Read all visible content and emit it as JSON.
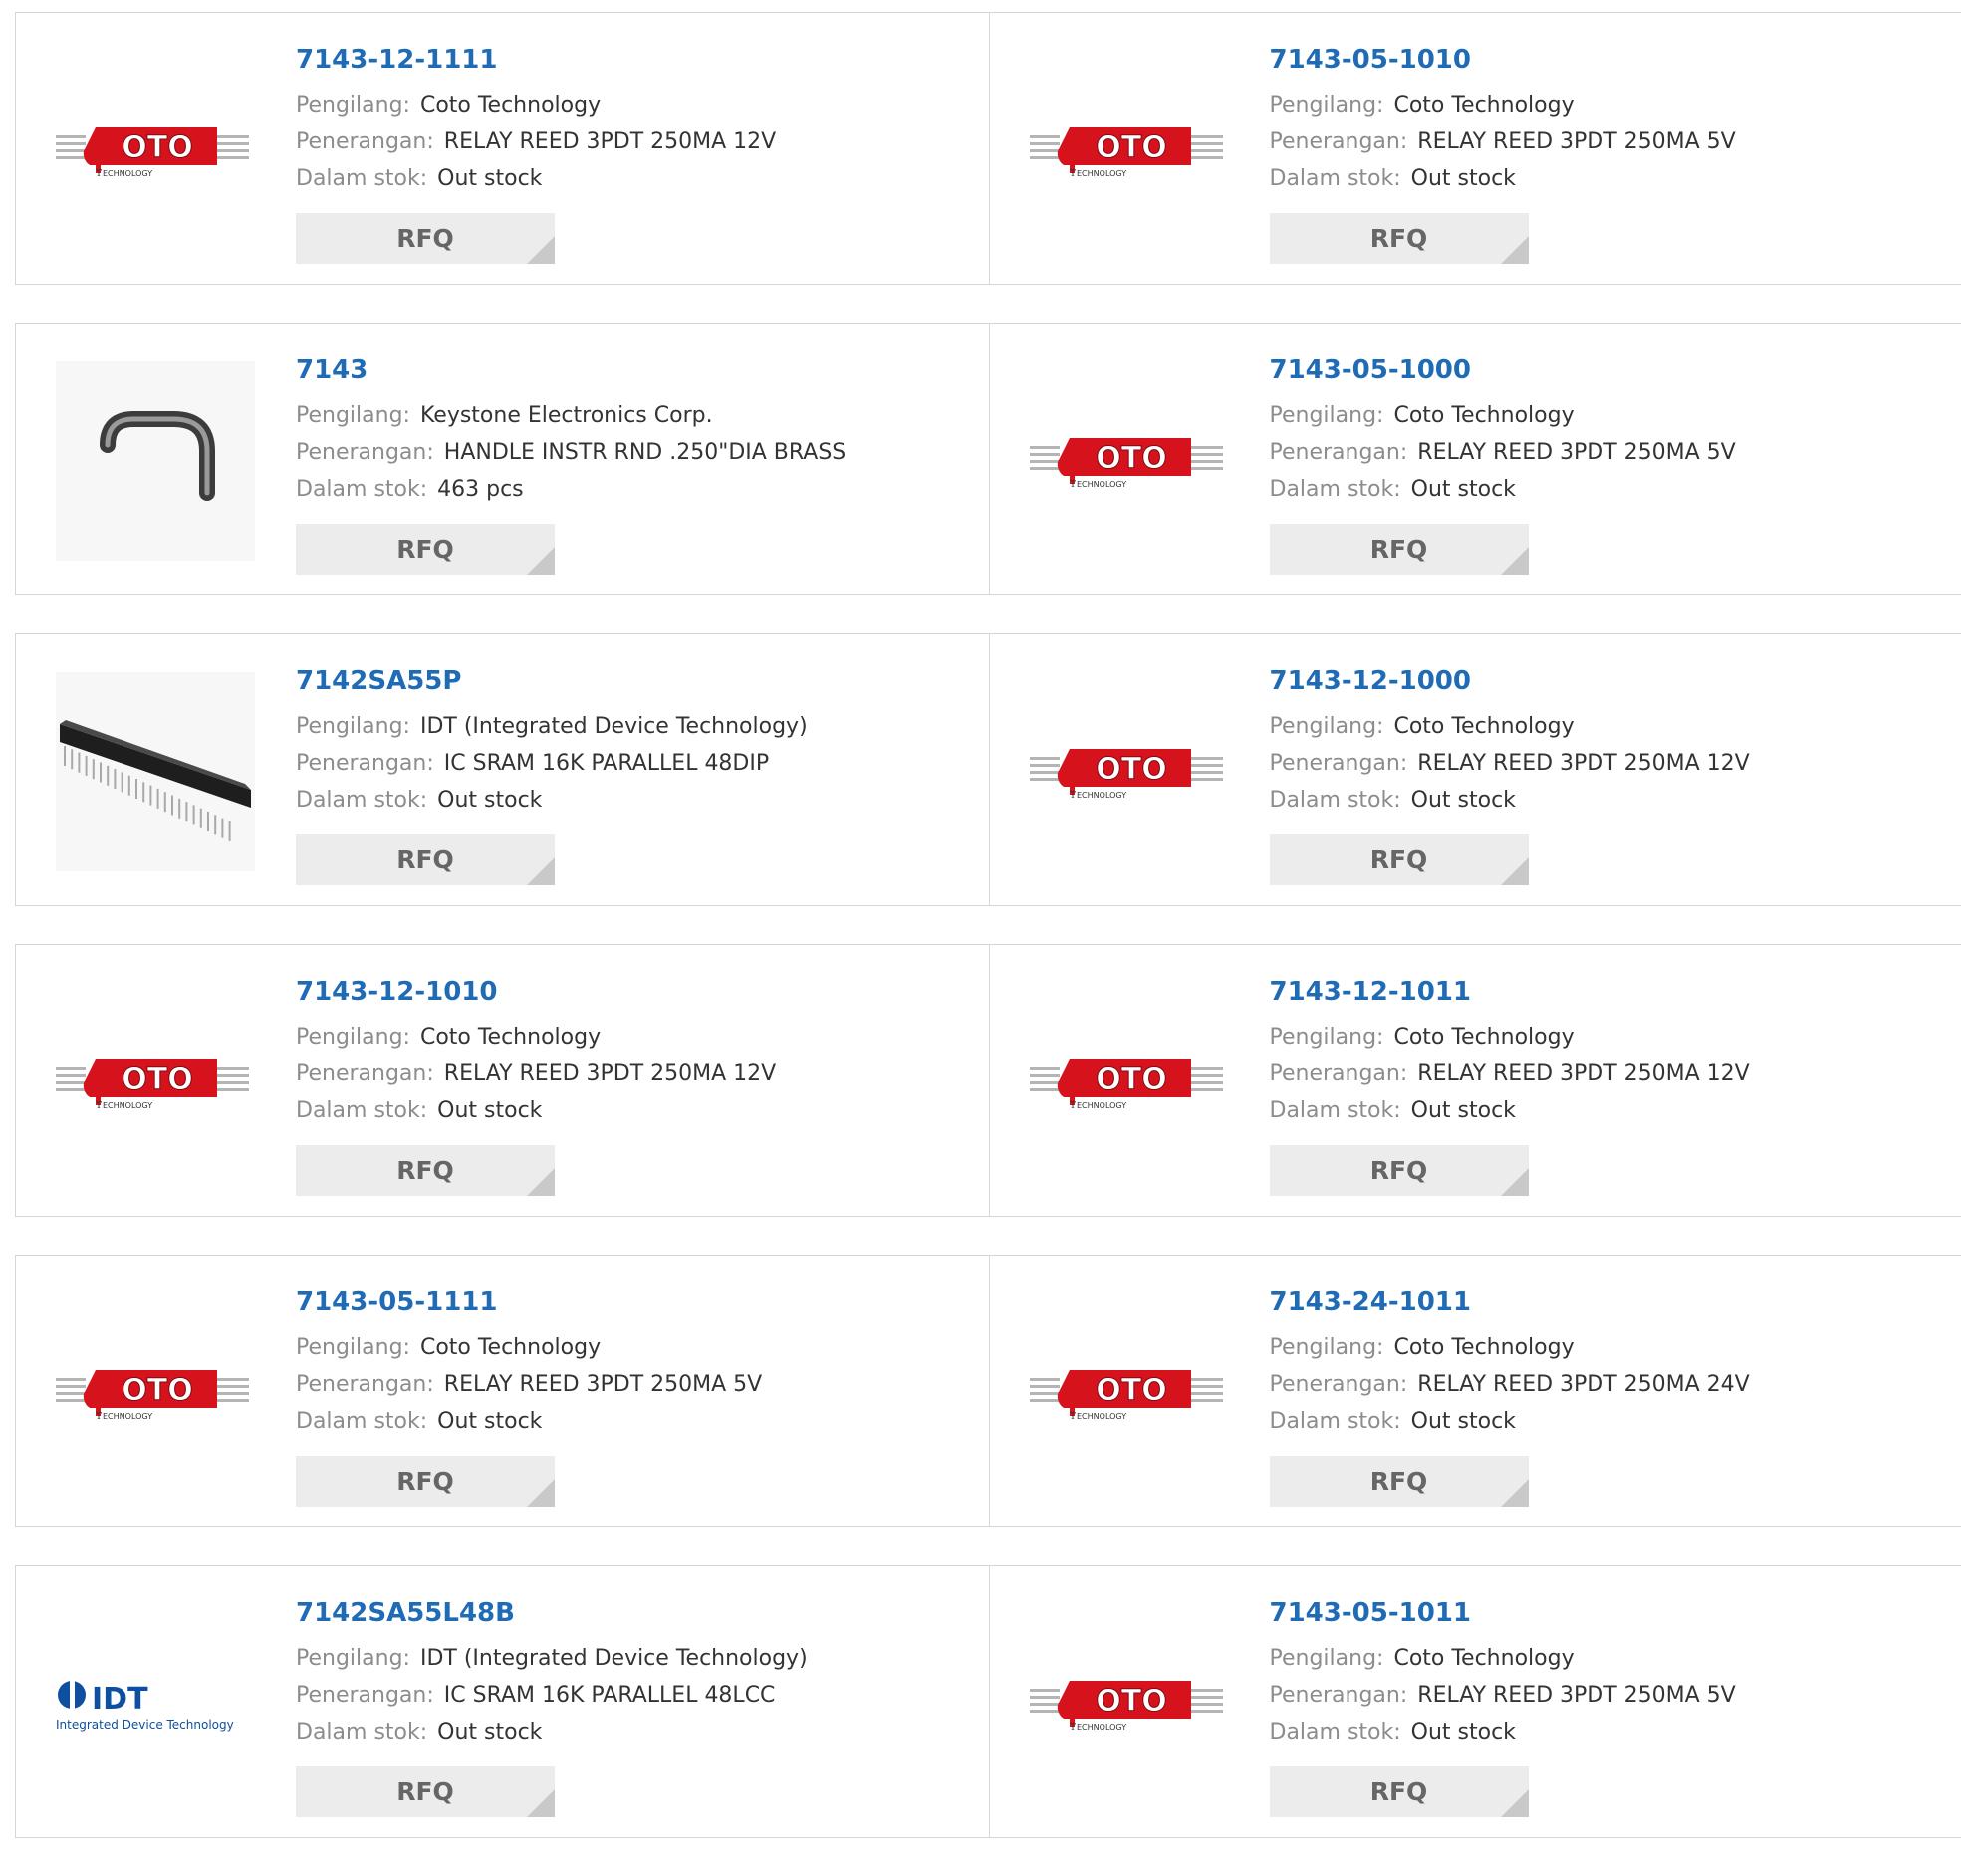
{
  "labels": {
    "manufacturer": "Pengilang:",
    "description": "Penerangan:",
    "stock": "Dalam stok:",
    "rfq": "RFQ"
  },
  "colors": {
    "part_link": "#1f6bb5",
    "label_gray": "#8c8c8c",
    "value_text": "#333333",
    "rfq_bg": "#ececec",
    "coto_red": "#d6121d",
    "idt_blue": "#0f4fa0"
  },
  "products": [
    {
      "part": "7143-12-1111",
      "manufacturer": "Coto Technology",
      "description": "RELAY REED 3PDT 250MA 12V",
      "stock": "Out stock",
      "image_icon": "coto-technology-logo"
    },
    {
      "part": "7143-05-1010",
      "manufacturer": "Coto Technology",
      "description": "RELAY REED 3PDT 250MA 5V",
      "stock": "Out stock",
      "image_icon": "coto-technology-logo"
    },
    {
      "part": "7143",
      "manufacturer": "Keystone Electronics Corp.",
      "description": "HANDLE INSTR RND .250\"DIA BRASS",
      "stock": "463 pcs",
      "image_icon": "handle-product-image"
    },
    {
      "part": "7143-05-1000",
      "manufacturer": "Coto Technology",
      "description": "RELAY REED 3PDT 250MA 5V",
      "stock": "Out stock",
      "image_icon": "coto-technology-logo"
    },
    {
      "part": "7142SA55P",
      "manufacturer": "IDT (Integrated Device Technology)",
      "description": "IC SRAM 16K PARALLEL 48DIP",
      "stock": "Out stock",
      "image_icon": "dip-chip-product-image"
    },
    {
      "part": "7143-12-1000",
      "manufacturer": "Coto Technology",
      "description": "RELAY REED 3PDT 250MA 12V",
      "stock": "Out stock",
      "image_icon": "coto-technology-logo"
    },
    {
      "part": "7143-12-1010",
      "manufacturer": "Coto Technology",
      "description": "RELAY REED 3PDT 250MA 12V",
      "stock": "Out stock",
      "image_icon": "coto-technology-logo"
    },
    {
      "part": "7143-12-1011",
      "manufacturer": "Coto Technology",
      "description": "RELAY REED 3PDT 250MA 12V",
      "stock": "Out stock",
      "image_icon": "coto-technology-logo"
    },
    {
      "part": "7143-05-1111",
      "manufacturer": "Coto Technology",
      "description": "RELAY REED 3PDT 250MA 5V",
      "stock": "Out stock",
      "image_icon": "coto-technology-logo"
    },
    {
      "part": "7143-24-1011",
      "manufacturer": "Coto Technology",
      "description": "RELAY REED 3PDT 250MA 24V",
      "stock": "Out stock",
      "image_icon": "coto-technology-logo"
    },
    {
      "part": "7142SA55L48B",
      "manufacturer": "IDT (Integrated Device Technology)",
      "description": "IC SRAM 16K PARALLEL 48LCC",
      "stock": "Out stock",
      "image_icon": "idt-logo"
    },
    {
      "part": "7143-05-1011",
      "manufacturer": "Coto Technology",
      "description": "RELAY REED 3PDT 250MA 5V",
      "stock": "Out stock",
      "image_icon": "coto-technology-logo"
    }
  ]
}
